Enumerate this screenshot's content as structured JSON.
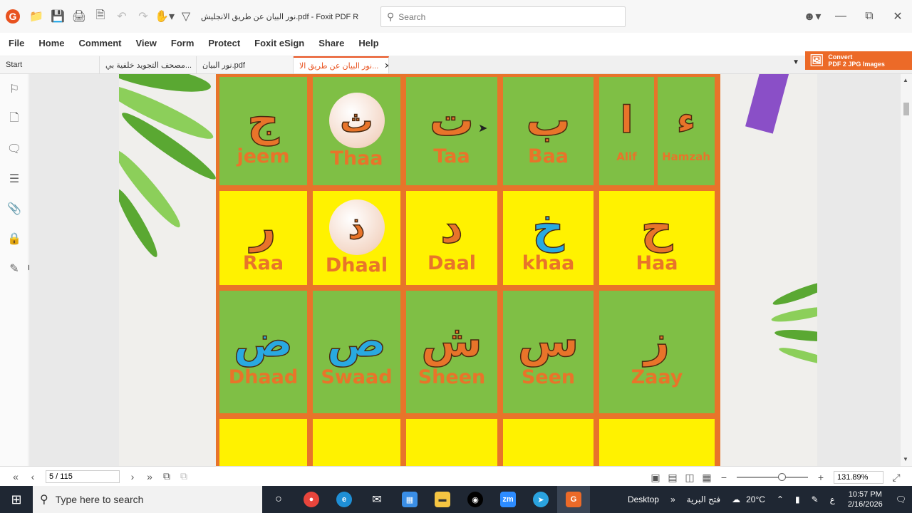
{
  "titlebar": {
    "doc_title": "نور البيان عن طريق الانجليش.pdf - Foxit PDF R...",
    "search_placeholder": "Search"
  },
  "menu": [
    "File",
    "Home",
    "Comment",
    "View",
    "Form",
    "Protect",
    "Foxit eSign",
    "Share",
    "Help"
  ],
  "tabs": [
    {
      "label": "Start",
      "active": false
    },
    {
      "label": "مصحف التجويد خلفية بي...",
      "active": false
    },
    {
      "label": "نور البيان.pdf",
      "active": false
    },
    {
      "label": "نور البيان عن طريق الا...",
      "active": true
    }
  ],
  "convert": {
    "line1": "Convert",
    "line2": "PDF 2 JPG Images"
  },
  "letters": {
    "row1": [
      {
        "ar": "ج",
        "name": "jeem"
      },
      {
        "ar": "ث",
        "name": "Thaa"
      },
      {
        "ar": "ت",
        "name": "Taa"
      },
      {
        "ar": "ب",
        "name": "Baa"
      },
      {
        "ar": "ا",
        "name": "Alif"
      },
      {
        "ar": "ء",
        "name": "Hamzah"
      }
    ],
    "row2": [
      {
        "ar": "ر",
        "name": "Raa"
      },
      {
        "ar": "ذ",
        "name": "Dhaal"
      },
      {
        "ar": "د",
        "name": "Daal"
      },
      {
        "ar": "خ",
        "name": "khaa"
      },
      {
        "ar": "ح",
        "name": "Haa"
      }
    ],
    "row3": [
      {
        "ar": "ض",
        "name": "Dhaad"
      },
      {
        "ar": "ص",
        "name": "Swaad"
      },
      {
        "ar": "ش",
        "name": "Sheen"
      },
      {
        "ar": "س",
        "name": "Seen"
      },
      {
        "ar": "ز",
        "name": "Zaay"
      }
    ]
  },
  "status": {
    "page": "5 / 115",
    "zoom": "131.89%"
  },
  "taskbar": {
    "search_placeholder": "Type here to search",
    "desktop_label": "Desktop",
    "arabic_label": "فتح البرية",
    "weather": "20°C",
    "lang": "ع",
    "time": "10:57 PM",
    "date": "2/16/2026"
  }
}
